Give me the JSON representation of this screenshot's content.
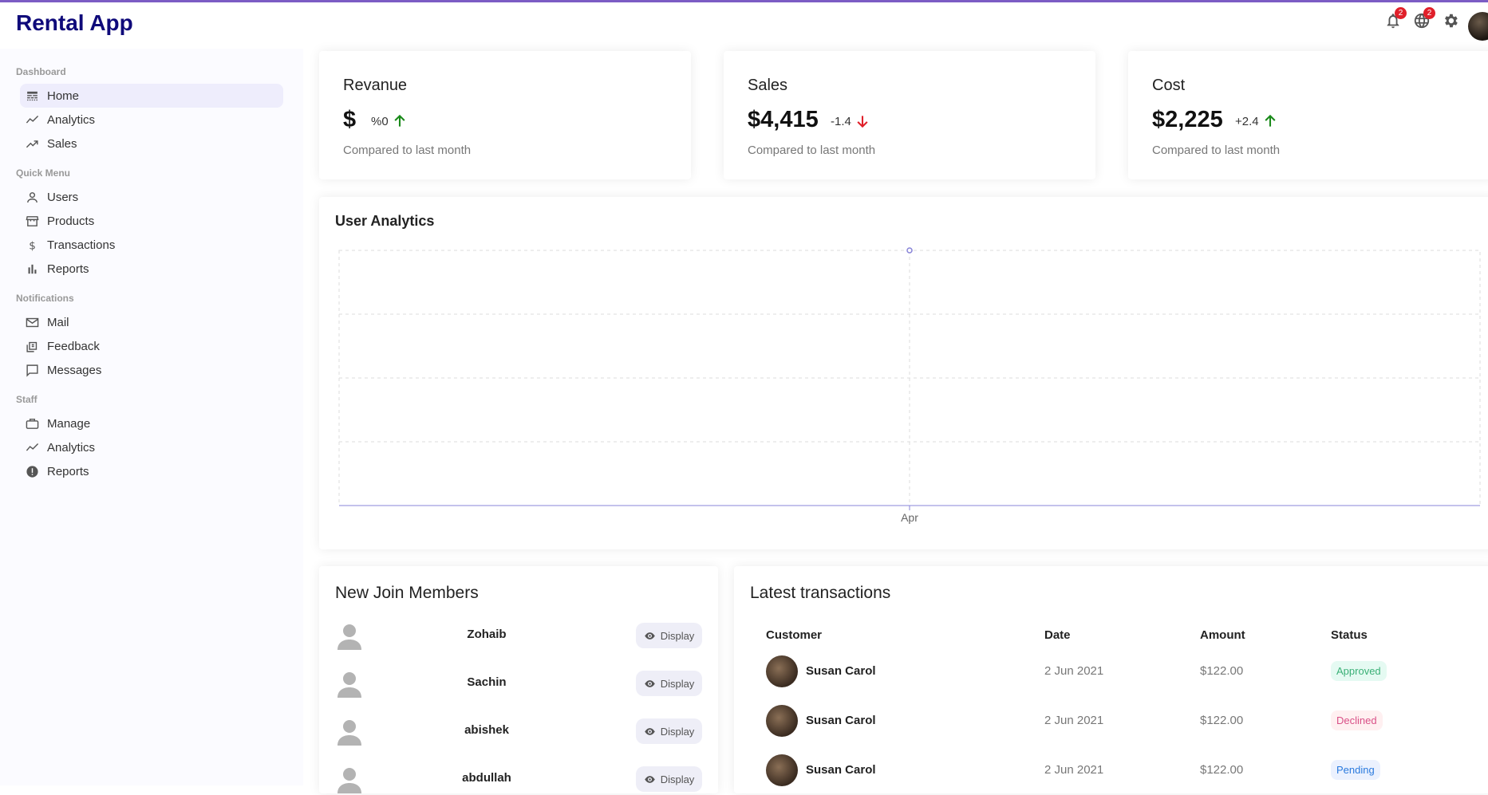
{
  "app": {
    "title": "Rental App"
  },
  "topbar": {
    "notifications_badge": "2",
    "language_badge": "2"
  },
  "sidebar": {
    "sections": [
      {
        "title": "Dashboard",
        "items": [
          {
            "label": "Home",
            "icon": "line-style-icon",
            "active": true
          },
          {
            "label": "Analytics",
            "icon": "timeline-icon"
          },
          {
            "label": "Sales",
            "icon": "trending-up-icon"
          }
        ]
      },
      {
        "title": "Quick Menu",
        "items": [
          {
            "label": "Users",
            "icon": "person-outline-icon"
          },
          {
            "label": "Products",
            "icon": "storefront-icon"
          },
          {
            "label": "Transactions",
            "icon": "dollar-icon"
          },
          {
            "label": "Reports",
            "icon": "bar-chart-icon"
          }
        ]
      },
      {
        "title": "Notifications",
        "items": [
          {
            "label": "Mail",
            "icon": "mail-outline-icon"
          },
          {
            "label": "Feedback",
            "icon": "dynamic-feed-icon"
          },
          {
            "label": "Messages",
            "icon": "chat-bubble-outline-icon"
          }
        ]
      },
      {
        "title": "Staff",
        "items": [
          {
            "label": "Manage",
            "icon": "work-outline-icon"
          },
          {
            "label": "Analytics",
            "icon": "timeline-icon"
          },
          {
            "label": "Reports",
            "icon": "report-icon"
          }
        ]
      }
    ]
  },
  "featured": [
    {
      "title": "Revanue",
      "money": "$",
      "rate": "%0",
      "trend": "up",
      "sub": "Compared to last month"
    },
    {
      "title": "Sales",
      "money": "$4,415",
      "rate": "-1.4",
      "trend": "down",
      "sub": "Compared to last month"
    },
    {
      "title": "Cost",
      "money": "$2,225",
      "rate": "+2.4",
      "trend": "up",
      "sub": "Compared to last month"
    }
  ],
  "chart": {
    "title": "User Analytics"
  },
  "chart_data": {
    "type": "line",
    "title": "User Analytics",
    "categories": [
      "Apr"
    ],
    "series": [
      {
        "values": [
          null
        ]
      }
    ],
    "grid": true,
    "xlabel": "",
    "ylabel": ""
  },
  "members": {
    "title": "New Join Members",
    "button_label": "Display",
    "list": [
      {
        "name": "Zohaib"
      },
      {
        "name": "Sachin"
      },
      {
        "name": "abishek"
      },
      {
        "name": "abdullah"
      }
    ]
  },
  "transactions": {
    "title": "Latest transactions",
    "headers": [
      "Customer",
      "Date",
      "Amount",
      "Status"
    ],
    "rows": [
      {
        "customer": "Susan Carol",
        "date": "2 Jun 2021",
        "amount": "$122.00",
        "status": "Approved"
      },
      {
        "customer": "Susan Carol",
        "date": "2 Jun 2021",
        "amount": "$122.00",
        "status": "Declined"
      },
      {
        "customer": "Susan Carol",
        "date": "2 Jun 2021",
        "amount": "$122.00",
        "status": "Pending"
      }
    ]
  },
  "colors": {
    "brand": "#0f0a7a",
    "accent": "#7c5cc4",
    "up": "#1a8a1a",
    "down": "#e0202a",
    "approved_bg": "#e5faf2",
    "approved_fg": "#3bb077",
    "declined_bg": "#fff0f1",
    "declined_fg": "#d95087",
    "pending_bg": "#ebf1fe",
    "pending_fg": "#2a7ade"
  }
}
